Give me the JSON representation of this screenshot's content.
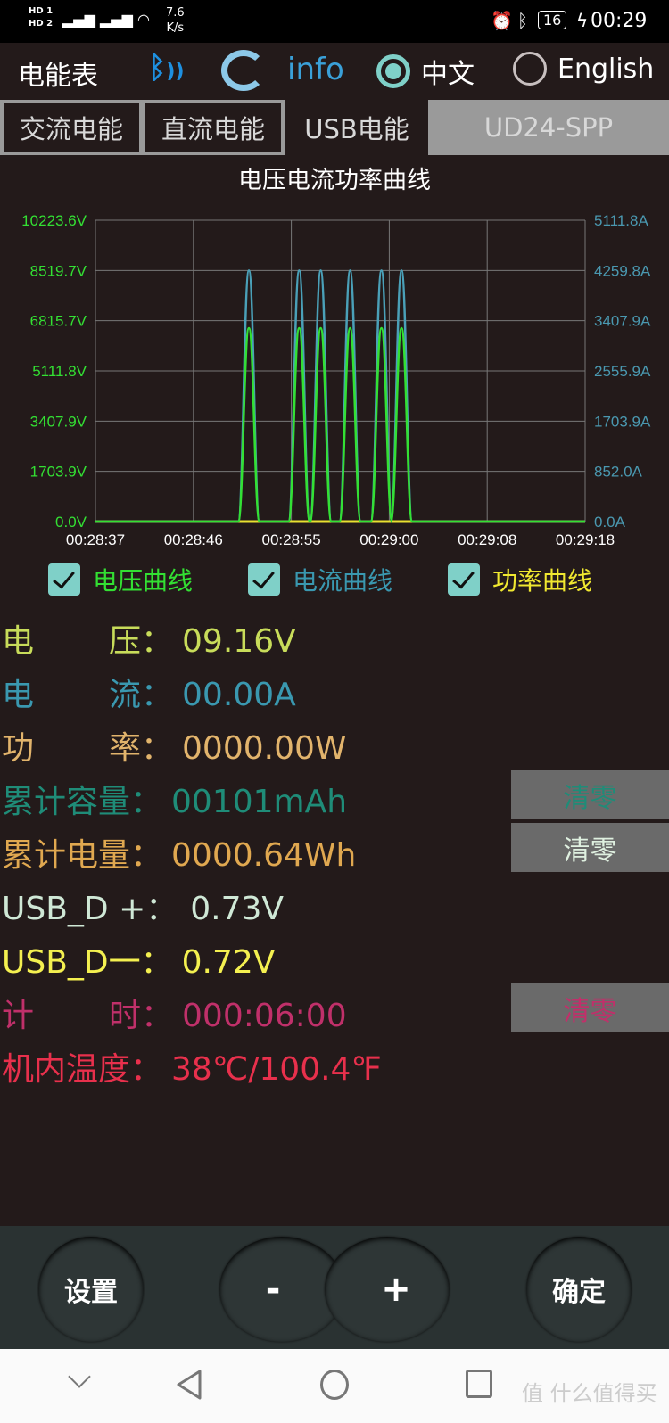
{
  "status_bar": {
    "net_speed": "7.6",
    "net_unit": "K/s",
    "battery": "16",
    "time": "00:29",
    "sim1": "HD 1",
    "sim2": "HD 2",
    "signal": "4G"
  },
  "header": {
    "title": "电能表",
    "info_label": "info",
    "lang_zh": "中文",
    "lang_en": "English",
    "selected_lang": "zh"
  },
  "tabs": [
    {
      "label": "交流电能"
    },
    {
      "label": "直流电能"
    },
    {
      "label": "USB电能",
      "active": true
    },
    {
      "label": "UD24-SPP"
    }
  ],
  "chart_data": {
    "type": "line",
    "title": "电压电流功率曲线",
    "x_ticks": [
      "00:28:37",
      "00:28:46",
      "00:28:55",
      "00:29:00",
      "00:29:08",
      "00:29:18"
    ],
    "y_left_ticks": [
      "0.0V",
      "1703.9V",
      "3407.9V",
      "5111.8V",
      "6815.7V",
      "8519.7V",
      "10223.6V"
    ],
    "y_right_ticks": [
      "0.0A",
      "852.0A",
      "1703.9A",
      "2555.9A",
      "3407.9A",
      "4259.8A",
      "5111.8A"
    ],
    "ylim_left": [
      0,
      10223.6
    ],
    "ylim_right": [
      0,
      5111.8
    ],
    "grid": true,
    "series": [
      {
        "name": "电压曲线",
        "axis": "left",
        "color": "#33e033",
        "peak_times": [
          "00:28:51.1",
          "00:28:55.4",
          "00:28:56.5",
          "00:28:58.0",
          "00:28:59.6",
          "00:29:01.0"
        ],
        "peak_value": 6565,
        "baseline": 0
      },
      {
        "name": "电流曲线",
        "axis": "right",
        "color": "#4aa0b8",
        "peak_times": [
          "00:28:51.1",
          "00:28:55.4",
          "00:28:56.5",
          "00:28:58.0",
          "00:28:59.6",
          "00:29:01.0"
        ],
        "peak_value": 4259.8,
        "baseline": 0
      },
      {
        "name": "功率曲线",
        "axis": "left",
        "color": "#e8e030",
        "peak_times": [],
        "peak_value": 0,
        "baseline": 0
      }
    ]
  },
  "legend": [
    {
      "label": "电压曲线",
      "checked": true,
      "color": "#33e033"
    },
    {
      "label": "电流曲线",
      "checked": true,
      "color": "#3a98b0"
    },
    {
      "label": "功率曲线",
      "checked": true,
      "color": "#f0e830"
    }
  ],
  "readings": [
    {
      "label_a": "电",
      "label_b": "压：",
      "value": "09.16V",
      "color": "#c8dc5a"
    },
    {
      "label_a": "电",
      "label_b": "流：",
      "value": "00.00A",
      "color": "#3a98b0"
    },
    {
      "label_a": "功",
      "label_b": "率：",
      "value": "0000.00W",
      "color": "#e2b46c"
    },
    {
      "label": "累计容量：",
      "value": "00101mAh",
      "color": "#1f8c78"
    },
    {
      "label": "累计电量：",
      "value": "0000.64Wh",
      "color": "#e0a850"
    },
    {
      "label": "USB_D +：",
      "value": "0.73V",
      "color": "#cfe8d6"
    },
    {
      "label": "USB_D一：",
      "value": "0.72V",
      "color": "#f4f050"
    },
    {
      "label_a": "计",
      "label_b": "时：",
      "value": "000:06:00",
      "color": "#c0306a"
    },
    {
      "label": "机内温度：",
      "value": "38℃/100.4℉",
      "color": "#e8304c"
    }
  ],
  "clear_buttons": [
    {
      "label": "清零",
      "color": "#1f8c78"
    },
    {
      "label": "清零",
      "color": "#dff0e0"
    },
    {
      "label": "清零",
      "color": "#c0306a"
    }
  ],
  "controls": {
    "settings": "设置",
    "minus": "-",
    "plus": "+",
    "confirm": "确定"
  },
  "watermark": "值 什么值得买"
}
